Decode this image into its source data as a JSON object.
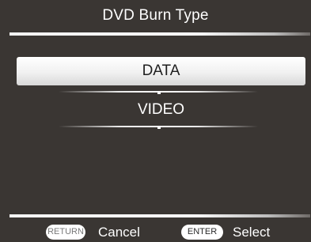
{
  "header": {
    "title": "DVD Burn Type"
  },
  "menu": {
    "items": [
      {
        "label": "DATA",
        "selected": true
      },
      {
        "label": "VIDEO",
        "selected": false
      }
    ]
  },
  "footer": {
    "return_key": "RETURN",
    "return_action": "Cancel",
    "enter_key": "ENTER",
    "enter_action": "Select"
  },
  "colors": {
    "background": "#3a3633",
    "text": "#ffffff",
    "highlight": "#f1f1f1",
    "highlight_text": "#1e1e1e"
  }
}
